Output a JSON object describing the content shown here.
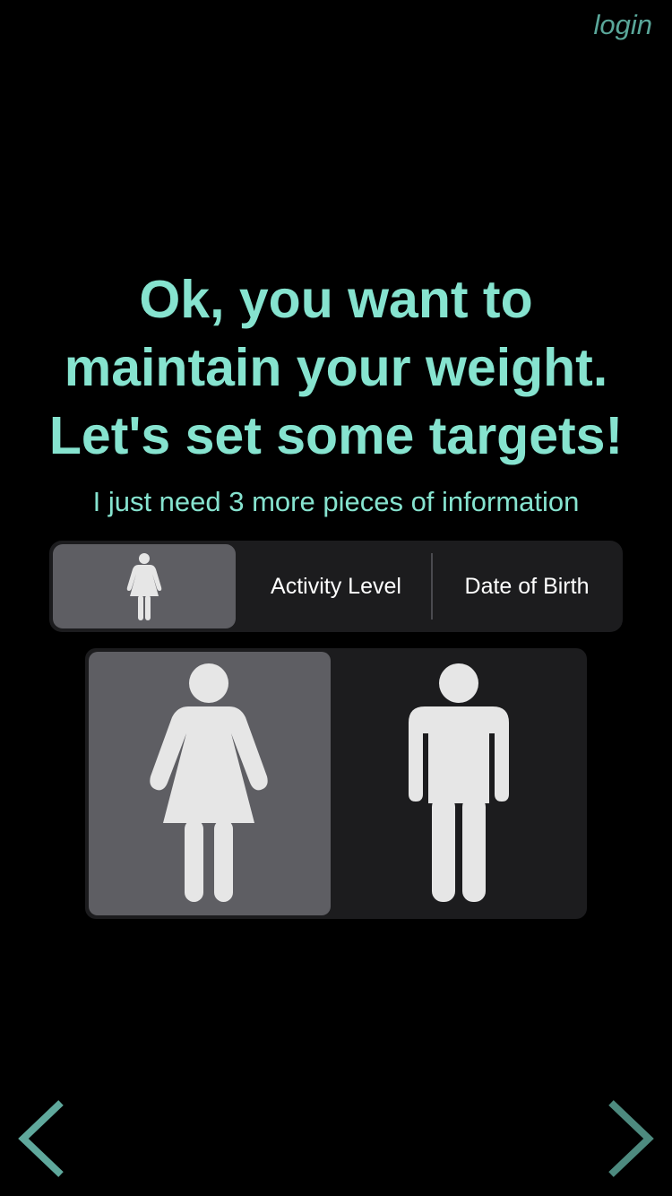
{
  "header": {
    "login_label": "login"
  },
  "headline": {
    "line1": "Ok, you want to",
    "line2": "maintain your weight.",
    "line3": "Let's set some targets!"
  },
  "subtitle": "I just need 3 more pieces of information",
  "segments": {
    "selected": "gender",
    "gender_icon": "female-icon",
    "activity_label": "Activity Level",
    "dob_label": "Date of Birth"
  },
  "gender_options": [
    {
      "icon": "female-icon",
      "selected": true
    },
    {
      "icon": "male-icon",
      "selected": false
    }
  ],
  "navigation": {
    "prev_icon": "chevron-left-icon",
    "next_icon": "chevron-right-icon"
  },
  "colors": {
    "accent": "#86e3cf",
    "login": "#5aa79a",
    "chevron_left": "#5fa89c",
    "chevron_right": "#4d8a7f",
    "selected_bg": "#5e5e63",
    "panel_bg": "#1c1c1e",
    "figure": "#e6e6e6"
  }
}
